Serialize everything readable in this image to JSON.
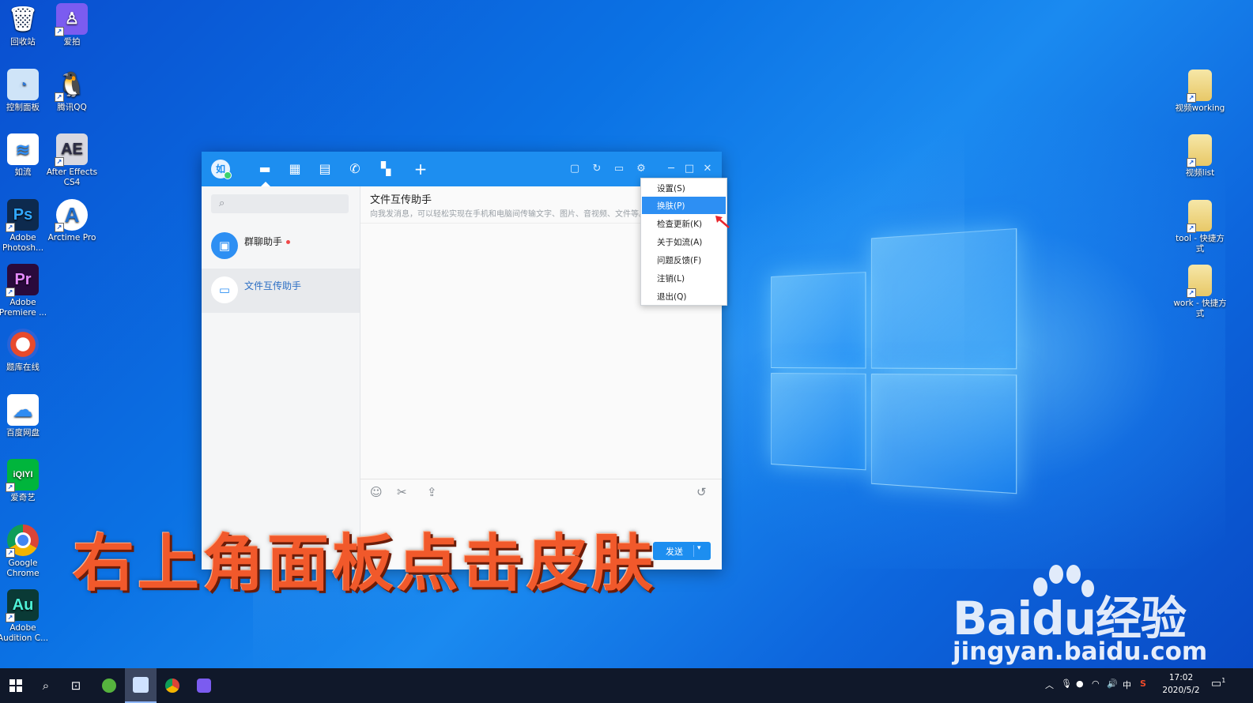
{
  "desktop": {
    "left_icons": [
      {
        "label": "回收站",
        "icon": "recycle-bin-icon",
        "color": "#5aa0e6"
      },
      {
        "label": "爱拍",
        "icon": "aipai-icon",
        "color": "#7b5cf0"
      },
      {
        "label": "控制面板",
        "icon": "control-panel-icon",
        "color": "#3c8ee0"
      },
      {
        "label": "腾讯QQ",
        "icon": "qq-penguin-icon",
        "color": "#111111"
      },
      {
        "label": "如流",
        "icon": "ruliu-icon",
        "color": "#2f8cf2"
      },
      {
        "label": "After Effects CS4",
        "icon": "after-effects-icon",
        "color": "#2c2c44",
        "glyph": "AE"
      },
      {
        "label": "Adobe Photosh...",
        "icon": "photoshop-icon",
        "color": "#0d2a4e",
        "glyph": "Ps"
      },
      {
        "label": "Arctime Pro",
        "icon": "arctime-icon",
        "color": "#ffffff",
        "glyph": "A"
      },
      {
        "label": "Adobe Premiere ...",
        "icon": "premiere-icon",
        "color": "#2a0a3c",
        "glyph": "Pr"
      },
      {
        "label": "题库在线",
        "icon": "tiku-icon",
        "color": "#e84a2c"
      },
      {
        "label": "百度网盘",
        "icon": "baidu-netdisk-icon",
        "color": "#2f8cf2"
      },
      {
        "label": "爱奇艺",
        "icon": "iqiyi-icon",
        "color": "#00b53c",
        "glyph": "iQIYI"
      },
      {
        "label": "Google Chrome",
        "icon": "chrome-icon",
        "color": "#db4437"
      },
      {
        "label": "Adobe Audition C...",
        "icon": "audition-icon",
        "color": "#0a3a36",
        "glyph": "Au"
      }
    ],
    "right_icons": [
      {
        "label": "视频working",
        "icon": "folder-icon"
      },
      {
        "label": "视频list",
        "icon": "folder-icon"
      },
      {
        "label": "tool - 快捷方式",
        "icon": "folder-icon"
      },
      {
        "label": "work - 快捷方式",
        "icon": "folder-icon"
      }
    ]
  },
  "app": {
    "contacts": [
      {
        "name": "群聊助手",
        "unread": true,
        "color": "#2d8ff3"
      },
      {
        "name": "文件互传助手",
        "unread": false,
        "color": "#e8eef6"
      }
    ],
    "chat_title": "文件互传助手",
    "chat_subtitle": "向我发消息，可以轻松实现在手机和电脑间传输文字、图片、音视频、文件等。",
    "send_label": "发送"
  },
  "menu": {
    "items": [
      {
        "label": "设置(S)",
        "active": false
      },
      {
        "label": "换肤(P)",
        "active": true
      },
      {
        "label": "检查更新(K)",
        "active": false
      },
      {
        "label": "关于如流(A)",
        "active": false
      },
      {
        "label": "问题反馈(F)",
        "active": false
      },
      {
        "label": "注销(L)",
        "active": false
      },
      {
        "label": "退出(Q)",
        "active": false
      }
    ]
  },
  "caption": "右上角面板点击皮肤",
  "watermark": {
    "brand": "Baidu经验",
    "url": "jingyan.baidu.com"
  },
  "taskbar": {
    "tray_ime": "中",
    "time": "17:02",
    "date": "2020/5/2",
    "notification_count": "1"
  }
}
